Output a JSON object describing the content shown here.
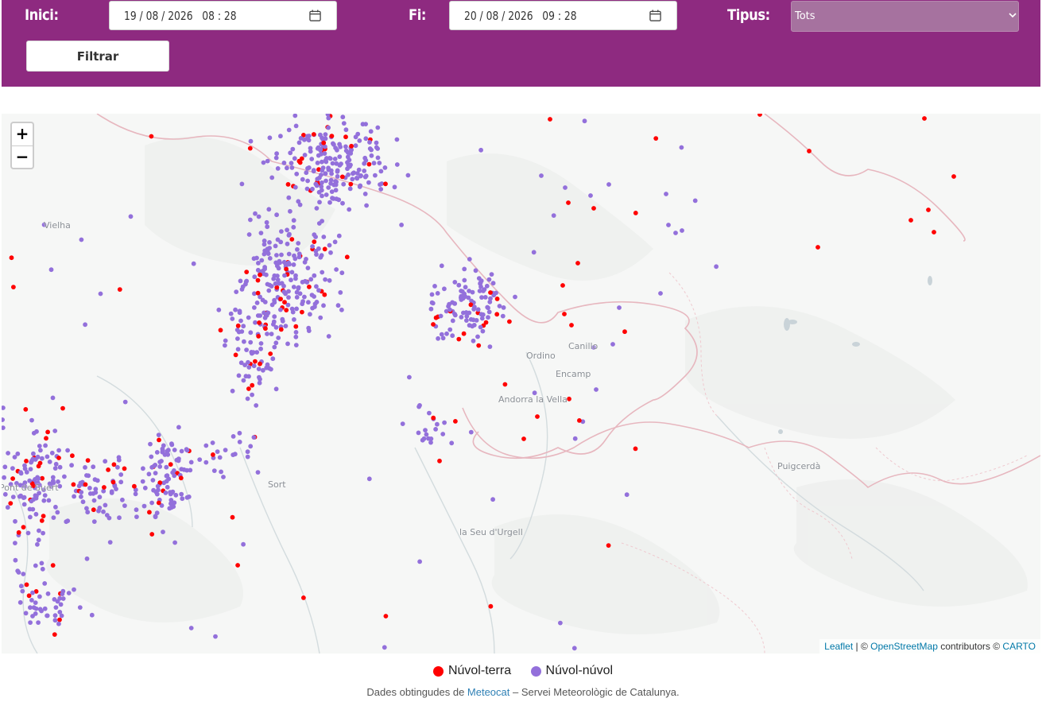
{
  "filters": {
    "start_label": "Inici:",
    "start_value": "19 / 08 / 2026   08 : 28",
    "end_label": "Fi:",
    "end_value": "20 / 08 / 2026   09 : 28",
    "type_label": "Tipus:",
    "type_selected": "Tots",
    "filter_button": "Filtrar"
  },
  "map": {
    "zoom_in": "+",
    "zoom_out": "−",
    "places": [
      "Vielha",
      "Sort",
      "la Seu d'Urgell",
      "Ordino",
      "Canillo",
      "Encamp",
      "Andorra la Vella",
      "Puigcerdà",
      "Pont de Suert"
    ],
    "attribution": {
      "leaflet": "Leaflet",
      "sep1": " | © ",
      "osm": "OpenStreetMap",
      "sep2": " contributors © ",
      "carto": "CARTO"
    },
    "colors": {
      "cloud_ground": "#ff0000",
      "cloud_cloud": "#9370db"
    }
  },
  "legend": {
    "cloud_ground": "Núvol-terra",
    "cloud_cloud": "Núvol-núvol"
  },
  "footer": {
    "prefix": "Dades obtingudes de ",
    "link": "Meteocat",
    "suffix": " – Servei Meteorològic de Catalunya."
  },
  "colors": {
    "header": "#8e2a80",
    "select_bg": "#a6729f"
  }
}
